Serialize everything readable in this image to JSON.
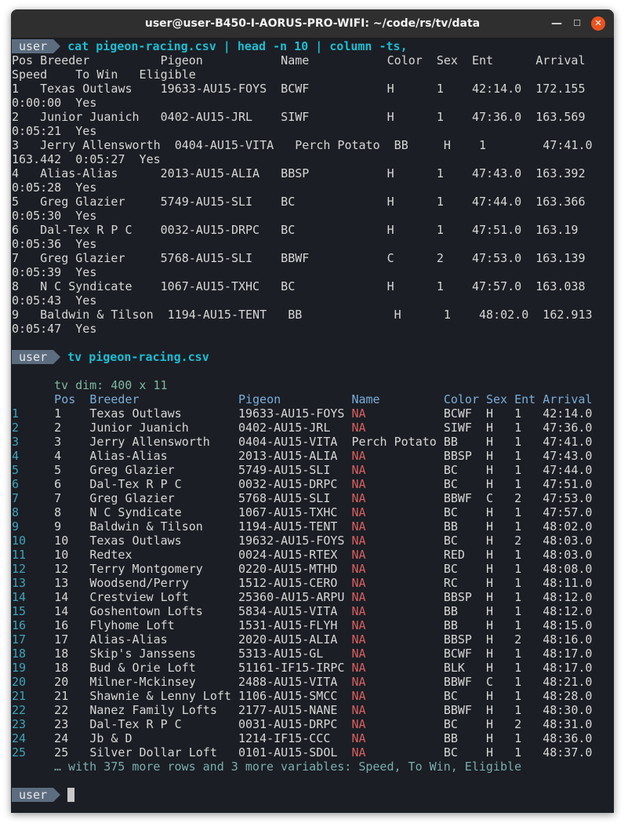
{
  "window": {
    "title": "user@user-B450-I-AORUS-PRO-WIFI: ~/code/rs/tv/data",
    "minimize": "—",
    "maximize": "☐",
    "close": "✕"
  },
  "prompt_user": "user",
  "command1": "cat pigeon-racing.csv | head -n 10 | column -ts,",
  "csv_lines": [
    "Pos Breeder          Pigeon           Name           Color  Sex  Ent      Arrival",
    "Speed    To Win   Eligible",
    "1   Texas Outlaws    19633-AU15-FOYS  BCWF           H      1    42:14.0  172.155",
    "0:00:00  Yes",
    "2   Junior Juanich   0402-AU15-JRL    SIWF           H      1    47:36.0  163.569",
    "0:05:21  Yes",
    "3   Jerry Allensworth  0404-AU15-VITA   Perch Potato  BB     H    1        47:41.0",
    "163.442  0:05:27  Yes",
    "4   Alias-Alias      2013-AU15-ALIA   BBSP           H      1    47:43.0  163.392",
    "0:05:28  Yes",
    "5   Greg Glazier     5749-AU15-SLI    BC             H      1    47:44.0  163.366",
    "0:05:30  Yes",
    "6   Dal-Tex R P C    0032-AU15-DRPC   BC             H      1    47:51.0  163.19",
    "0:05:36  Yes",
    "7   Greg Glazier     5768-AU15-SLI    BBWF           C      2    47:53.0  163.139",
    "0:05:39  Yes",
    "8   N C Syndicate    1067-AU15-TXHC   BC             H      1    47:57.0  163.038",
    "0:05:43  Yes",
    "9   Baldwin & Tilson  1194-AU15-TENT   BB             H      1    48:02.0  162.913",
    "0:05:47  Yes"
  ],
  "command2": "tv pigeon-racing.csv",
  "tv": {
    "dim": "tv dim: 400 x 11",
    "headers": [
      "Pos",
      "Breeder",
      "Pigeon",
      "Name",
      "Color",
      "Sex",
      "Ent",
      "Arrival"
    ],
    "rows": [
      [
        "1",
        "1",
        "Texas Outlaws",
        "19633-AU15-FOYS",
        "NA",
        "BCWF",
        "H",
        "1",
        "42:14.0"
      ],
      [
        "2",
        "2",
        "Junior Juanich",
        "0402-AU15-JRL",
        "NA",
        "SIWF",
        "H",
        "1",
        "47:36.0"
      ],
      [
        "3",
        "3",
        "Jerry Allensworth",
        "0404-AU15-VITA",
        "Perch Potato",
        "BB",
        "H",
        "1",
        "47:41.0"
      ],
      [
        "4",
        "4",
        "Alias-Alias",
        "2013-AU15-ALIA",
        "NA",
        "BBSP",
        "H",
        "1",
        "47:43.0"
      ],
      [
        "5",
        "5",
        "Greg Glazier",
        "5749-AU15-SLI",
        "NA",
        "BC",
        "H",
        "1",
        "47:44.0"
      ],
      [
        "6",
        "6",
        "Dal-Tex R P C",
        "0032-AU15-DRPC",
        "NA",
        "BC",
        "H",
        "1",
        "47:51.0"
      ],
      [
        "7",
        "7",
        "Greg Glazier",
        "5768-AU15-SLI",
        "NA",
        "BBWF",
        "C",
        "2",
        "47:53.0"
      ],
      [
        "8",
        "8",
        "N C Syndicate",
        "1067-AU15-TXHC",
        "NA",
        "BC",
        "H",
        "1",
        "47:57.0"
      ],
      [
        "9",
        "9",
        "Baldwin & Tilson",
        "1194-AU15-TENT",
        "NA",
        "BB",
        "H",
        "1",
        "48:02.0"
      ],
      [
        "10",
        "10",
        "Texas Outlaws",
        "19632-AU15-FOYS",
        "NA",
        "BC",
        "H",
        "2",
        "48:03.0"
      ],
      [
        "11",
        "10",
        "Redtex",
        "0024-AU15-RTEX",
        "NA",
        "RED",
        "H",
        "1",
        "48:03.0"
      ],
      [
        "12",
        "12",
        "Terry Montgomery",
        "0220-AU15-MTHD",
        "NA",
        "BC",
        "H",
        "1",
        "48:08.0"
      ],
      [
        "13",
        "13",
        "Woodsend/Perry",
        "1512-AU15-CERO",
        "NA",
        "RC",
        "H",
        "1",
        "48:11.0"
      ],
      [
        "14",
        "14",
        "Crestview Loft",
        "25360-AU15-ARPU",
        "NA",
        "BBSP",
        "H",
        "1",
        "48:12.0"
      ],
      [
        "15",
        "14",
        "Goshentown Lofts",
        "5834-AU15-VITA",
        "NA",
        "BB",
        "H",
        "1",
        "48:12.0"
      ],
      [
        "16",
        "16",
        "Flyhome Loft",
        "1531-AU15-FLYH",
        "NA",
        "BB",
        "H",
        "1",
        "48:15.0"
      ],
      [
        "17",
        "17",
        "Alias-Alias",
        "2020-AU15-ALIA",
        "NA",
        "BBSP",
        "H",
        "2",
        "48:16.0"
      ],
      [
        "18",
        "18",
        "Skip's Janssens",
        "5313-AU15-GL",
        "NA",
        "BCWF",
        "H",
        "1",
        "48:17.0"
      ],
      [
        "19",
        "18",
        "Bud & Orie Loft",
        "51161-IF15-IRPC",
        "NA",
        "BLK",
        "H",
        "1",
        "48:17.0"
      ],
      [
        "20",
        "20",
        "Milner-Mckinsey",
        "2488-AU15-VITA",
        "NA",
        "BBWF",
        "C",
        "1",
        "48:21.0"
      ],
      [
        "21",
        "21",
        "Shawnie & Lenny Loft",
        "1106-AU15-SMCC",
        "NA",
        "BC",
        "H",
        "1",
        "48:28.0"
      ],
      [
        "22",
        "22",
        "Nanez Family Lofts",
        "2177-AU15-NANE",
        "NA",
        "BBWF",
        "H",
        "1",
        "48:30.0"
      ],
      [
        "23",
        "23",
        "Dal-Tex R P C",
        "0031-AU15-DRPC",
        "NA",
        "BC",
        "H",
        "2",
        "48:31.0"
      ],
      [
        "24",
        "24",
        "Jb & D",
        "1214-IF15-CCC",
        "NA",
        "BB",
        "H",
        "1",
        "48:36.0"
      ],
      [
        "25",
        "25",
        "Silver Dollar Loft",
        "0101-AU15-SDOL",
        "NA",
        "BC",
        "H",
        "1",
        "48:37.0"
      ]
    ],
    "footer": "… with 375 more rows and 3 more variables: Speed, To Win, Eligible"
  }
}
